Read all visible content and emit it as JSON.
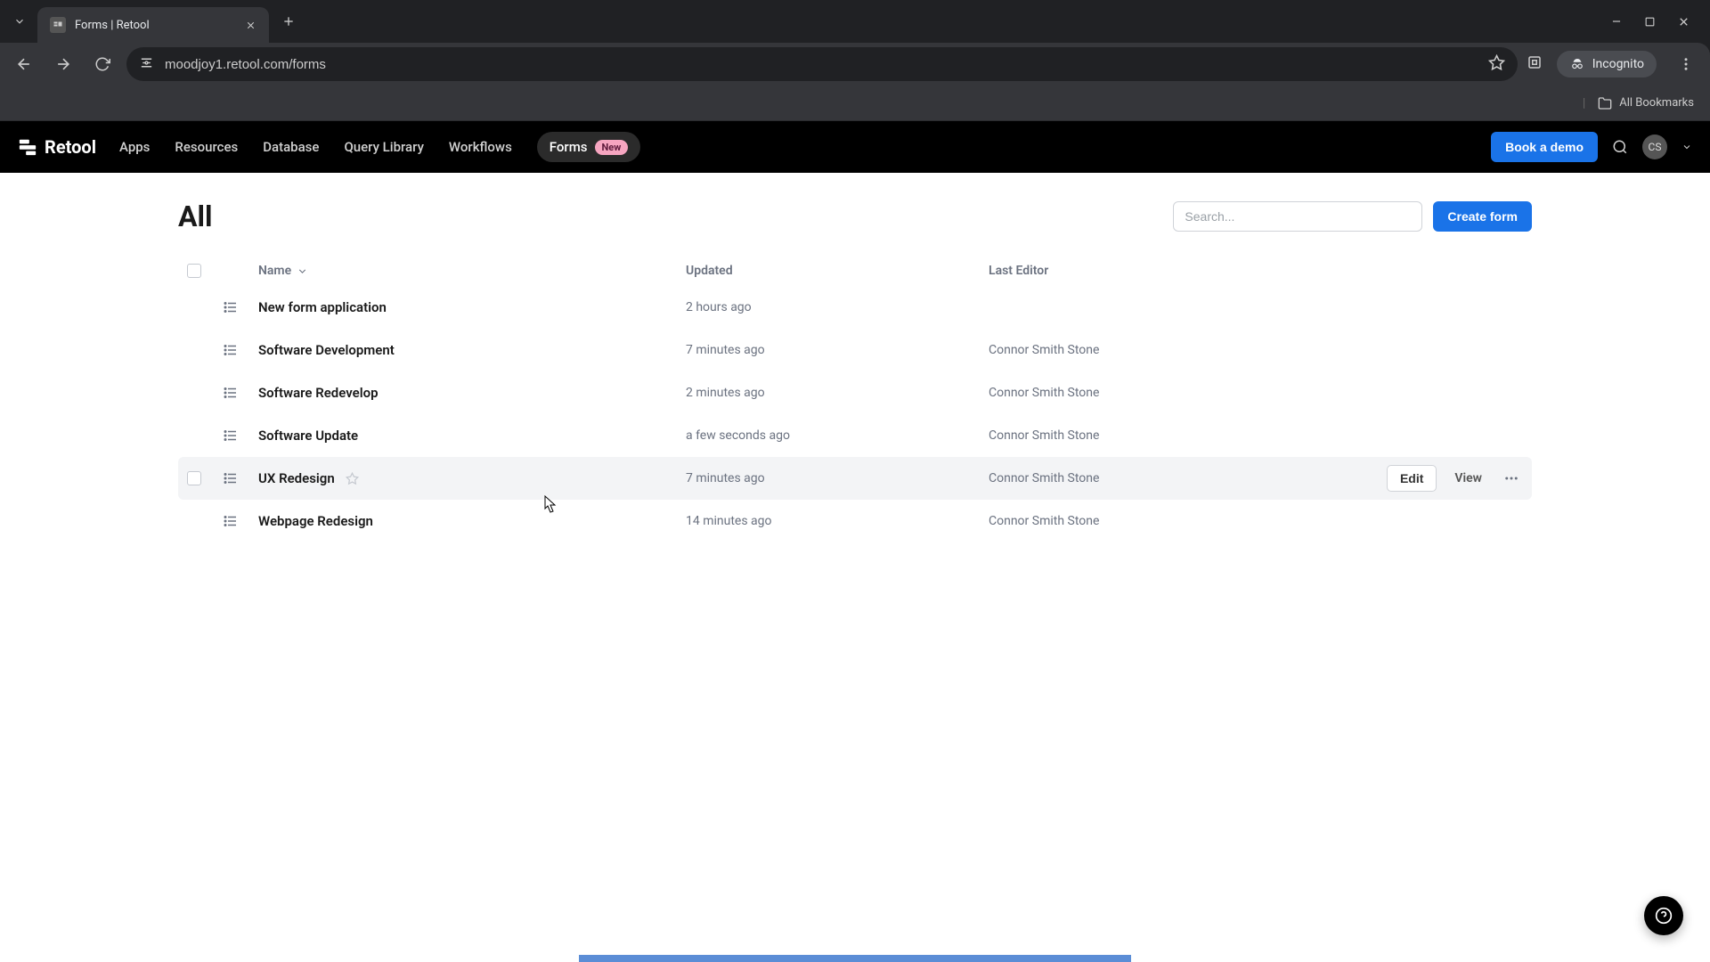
{
  "browser": {
    "tab_title": "Forms | Retool",
    "url": "moodjoy1.retool.com/forms",
    "incognito_label": "Incognito",
    "bookmarks_label": "All Bookmarks"
  },
  "header": {
    "brand": "Retool",
    "nav": {
      "apps": "Apps",
      "resources": "Resources",
      "database": "Database",
      "query_library": "Query Library",
      "workflows": "Workflows",
      "forms": "Forms",
      "forms_badge": "New"
    },
    "book_demo": "Book a demo",
    "avatar_initials": "CS"
  },
  "page": {
    "title": "All",
    "search_placeholder": "Search...",
    "create_button": "Create form",
    "columns": {
      "name": "Name",
      "updated": "Updated",
      "last_editor": "Last Editor"
    },
    "actions": {
      "edit": "Edit",
      "view": "View"
    },
    "rows": [
      {
        "name": "New form application",
        "updated": "2 hours ago",
        "editor": ""
      },
      {
        "name": "Software Development",
        "updated": "7 minutes ago",
        "editor": "Connor Smith Stone"
      },
      {
        "name": "Software Redevelop",
        "updated": "2 minutes ago",
        "editor": "Connor Smith Stone"
      },
      {
        "name": "Software Update",
        "updated": "a few seconds ago",
        "editor": "Connor Smith Stone"
      },
      {
        "name": "UX Redesign",
        "updated": "7 minutes ago",
        "editor": "Connor Smith Stone"
      },
      {
        "name": "Webpage Redesign",
        "updated": "14 minutes ago",
        "editor": "Connor Smith Stone"
      }
    ],
    "hovered_index": 4
  }
}
